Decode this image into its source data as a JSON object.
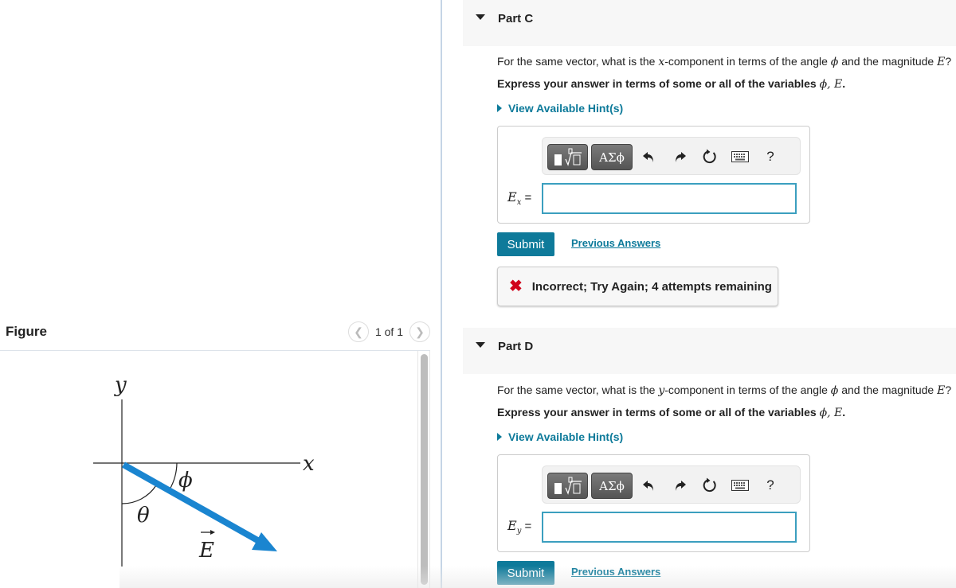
{
  "figure": {
    "title": "Figure",
    "pager": {
      "prev_icon": "chevron-left-icon",
      "next_icon": "chevron-right-icon",
      "text": "1 of 1"
    },
    "diagram": {
      "x_label": "x",
      "y_label": "y",
      "angle_phi_label": "ϕ",
      "angle_theta_label": "θ",
      "vector_label": "E",
      "vector_color": "#1a85d0"
    }
  },
  "parts": [
    {
      "title": "Part C",
      "question_pre": "For the same vector, what is the ",
      "question_var": "x",
      "question_post": "-component in terms of the angle ",
      "question_phi": "ϕ",
      "question_mid": " and the magnitude ",
      "question_E": "E",
      "question_end": "?",
      "instruction": "Express your answer in terms of some or all of the variables ",
      "instruction_vars": "ϕ, E",
      "instruction_end": ".",
      "hint_label": "View Available Hint(s)",
      "toolbar": {
        "templates_icon": "templates-icon",
        "greek_label": "ΑΣϕ",
        "undo_icon": "undo-icon",
        "redo_icon": "redo-icon",
        "reset_icon": "reset-icon",
        "keyboard_icon": "keyboard-icon",
        "help_label": "?"
      },
      "answer_label_base": "E",
      "answer_label_sub": "x",
      "answer_label_eq": " =",
      "answer_value": "",
      "submit_label": "Submit",
      "previous_answers_label": "Previous Answers",
      "feedback": "Incorrect; Try Again; 4 attempts remaining",
      "feedback_icon": "x-icon"
    },
    {
      "title": "Part D",
      "question_pre": "For the same vector, what is the ",
      "question_var": "y",
      "question_post": "-component in terms of the angle ",
      "question_phi": "ϕ",
      "question_mid": " and the magnitude ",
      "question_E": "E",
      "question_end": "?",
      "instruction": "Express your answer in terms of some or all of the variables ",
      "instruction_vars": "ϕ, E",
      "instruction_end": ".",
      "hint_label": "View Available Hint(s)",
      "toolbar": {
        "greek_label": "ΑΣϕ",
        "help_label": "?"
      },
      "answer_label_base": "E",
      "answer_label_sub": "y",
      "answer_label_eq": " =",
      "answer_value": "",
      "submit_label": "Submit",
      "previous_answers_label": "Previous Answers"
    }
  ],
  "colors": {
    "accent": "#0e7a9a",
    "link": "#0d7a9a",
    "error": "#d0021b",
    "input_border": "#3b9fbf"
  }
}
